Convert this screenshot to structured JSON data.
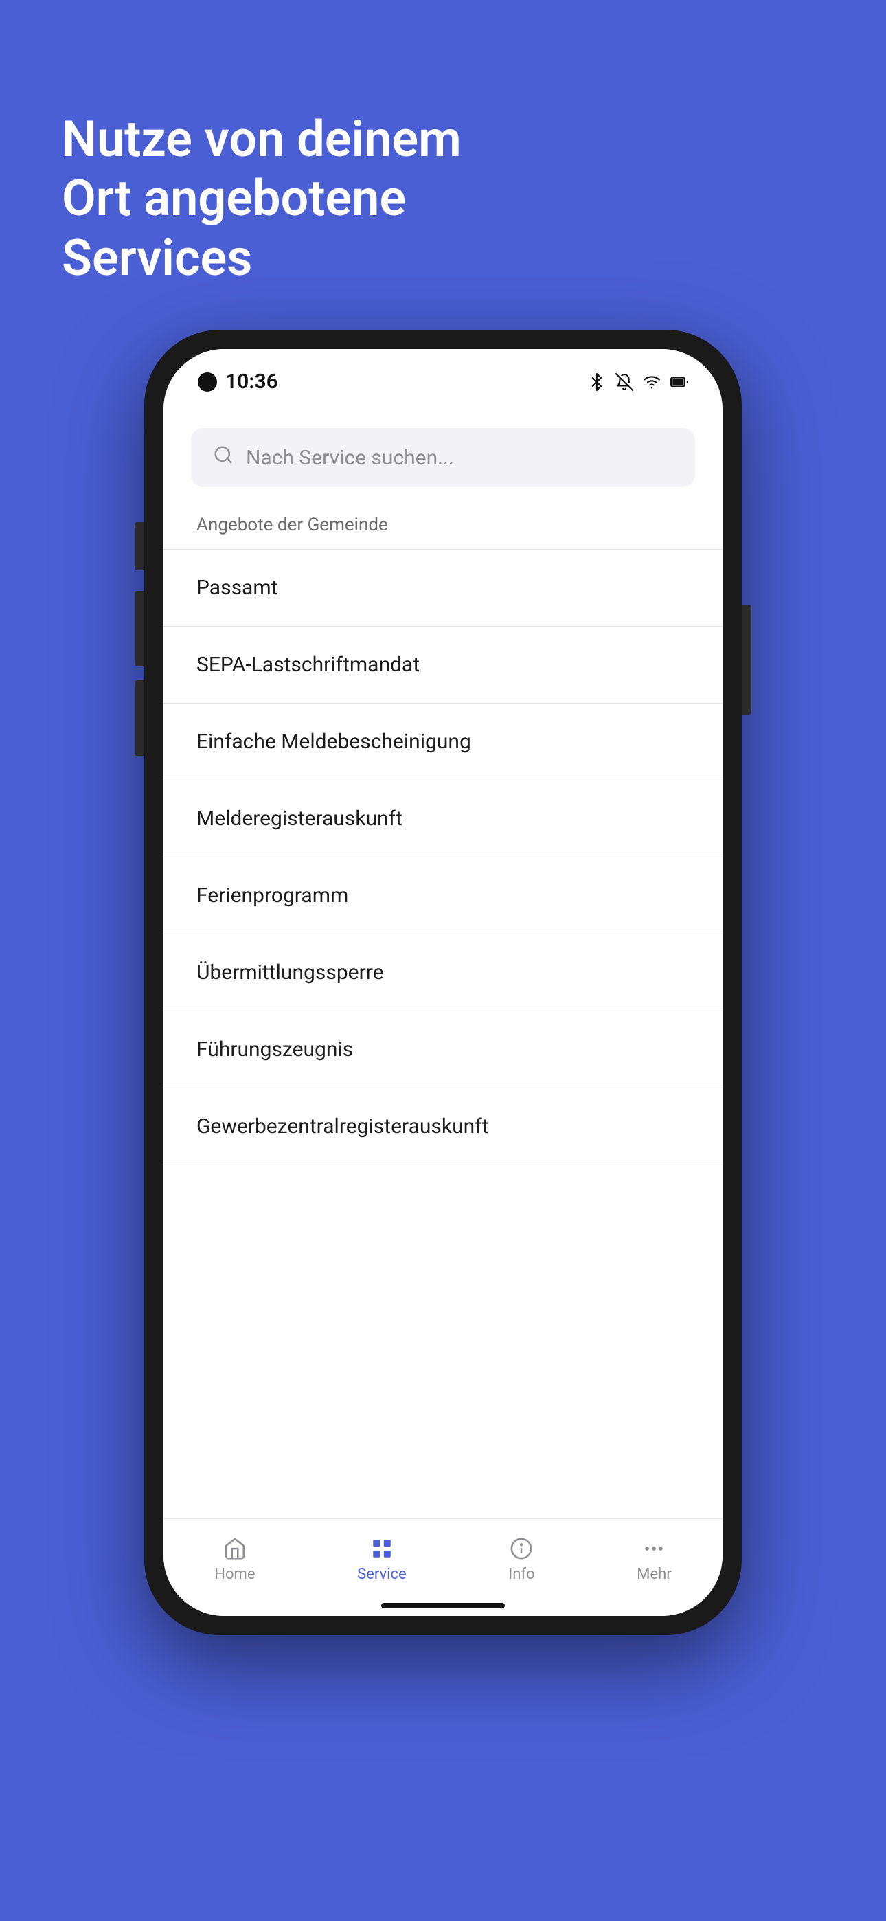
{
  "background_color": "#4a5fd4",
  "hero": {
    "text": "Nutze von deinem Ort angebotene Services"
  },
  "status_bar": {
    "time": "10:36",
    "icons": [
      "bluetooth",
      "bell-off",
      "wifi",
      "battery"
    ]
  },
  "search": {
    "placeholder": "Nach Service suchen..."
  },
  "section": {
    "title": "Angebote der Gemeinde"
  },
  "services": [
    {
      "label": "Passamt"
    },
    {
      "label": "SEPA-Lastschriftmandat"
    },
    {
      "label": "Einfache Meldebescheinigung"
    },
    {
      "label": "Melderegisterauskunft"
    },
    {
      "label": "Ferienprogramm"
    },
    {
      "label": "Übermittlungssperre"
    },
    {
      "label": "Führungszeugnis"
    },
    {
      "label": "Gewerbezentralregisterauskunft"
    }
  ],
  "bottom_nav": {
    "items": [
      {
        "id": "home",
        "label": "Home",
        "active": false
      },
      {
        "id": "service",
        "label": "Service",
        "active": true
      },
      {
        "id": "info",
        "label": "Info",
        "active": false
      },
      {
        "id": "mehr",
        "label": "Mehr",
        "active": false
      }
    ]
  }
}
